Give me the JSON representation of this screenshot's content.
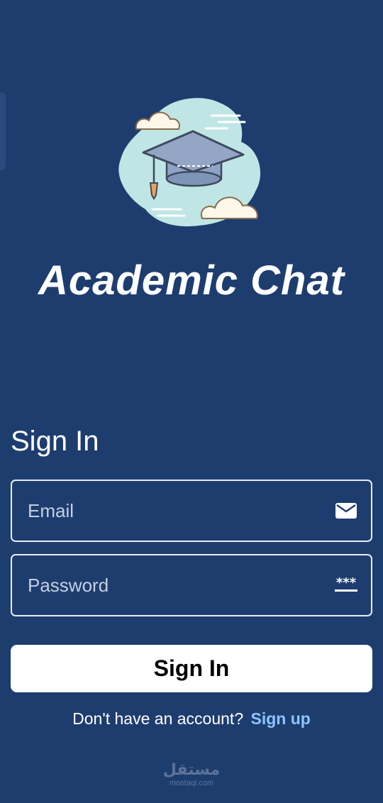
{
  "app": {
    "title": "Academic Chat"
  },
  "signin": {
    "heading": "Sign In",
    "email_placeholder": "Email",
    "password_placeholder": "Password",
    "submit_label": "Sign In",
    "no_account_text": "Don't have an account?",
    "signup_link": "Sign up"
  },
  "watermark": {
    "main": "مستقل",
    "sub": "mostaql.com"
  },
  "icons": {
    "logo": "graduation-cap-icon",
    "email": "envelope-icon",
    "password": "password-dots-icon"
  },
  "colors": {
    "background": "#1e3d6f",
    "link": "#8fc4ff",
    "button_bg": "#ffffff",
    "logo_blob": "#bfe6e4",
    "cap": "#7f95b8"
  }
}
